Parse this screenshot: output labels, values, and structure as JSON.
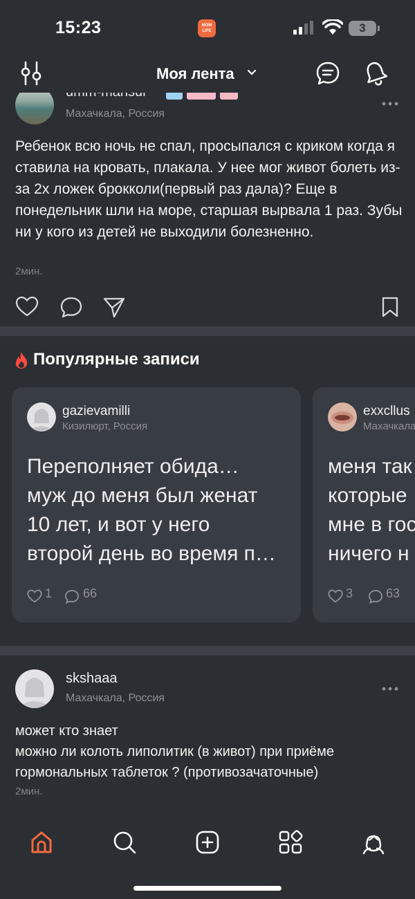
{
  "status_bar": {
    "time": "15:23",
    "battery": "3",
    "app_badge": "MOM LIFE"
  },
  "header": {
    "title": "Моя лента"
  },
  "post1": {
    "username": "umm-mansur",
    "location": "Махачкала, Россия",
    "text": "Ребенок всю ночь не спал, просыпался с криком когда я ставила на кровать, плакала. У нее мог живот болеть из-за 2х ложек брокколи(первый раз дала)? Еще в понедельник шли на море, старшая вырвала 1 раз. Зубы ни у кого из детей не выходили болезненно.",
    "time": "2мин."
  },
  "popular": {
    "title": "Популярные записи",
    "cards": [
      {
        "username": "gazievamilli",
        "location": "Кизилюрт, Россия",
        "text": "Переполняет обида…\nмуж до меня был женат\n10 лет, и вот у него\nвторой день во время п…",
        "likes": "1",
        "comments": "66"
      },
      {
        "username": "exxcllus",
        "location": "Махачкала",
        "text": "меня так\nкоторые\nмне в гос\nничего н",
        "likes": "3",
        "comments": "63"
      }
    ]
  },
  "post2": {
    "username": "skshaaa",
    "location": "Махачкала, Россия",
    "text": "может кто знает\nможно ли колоть липолитик (в живот) при приёме гормональных таблеток ? (противозачаточные)",
    "time": "2мин."
  },
  "colors": {
    "accent": "#f06a3f",
    "background": "#2b2e33",
    "card": "#383c43",
    "divider": "#3d4046"
  }
}
